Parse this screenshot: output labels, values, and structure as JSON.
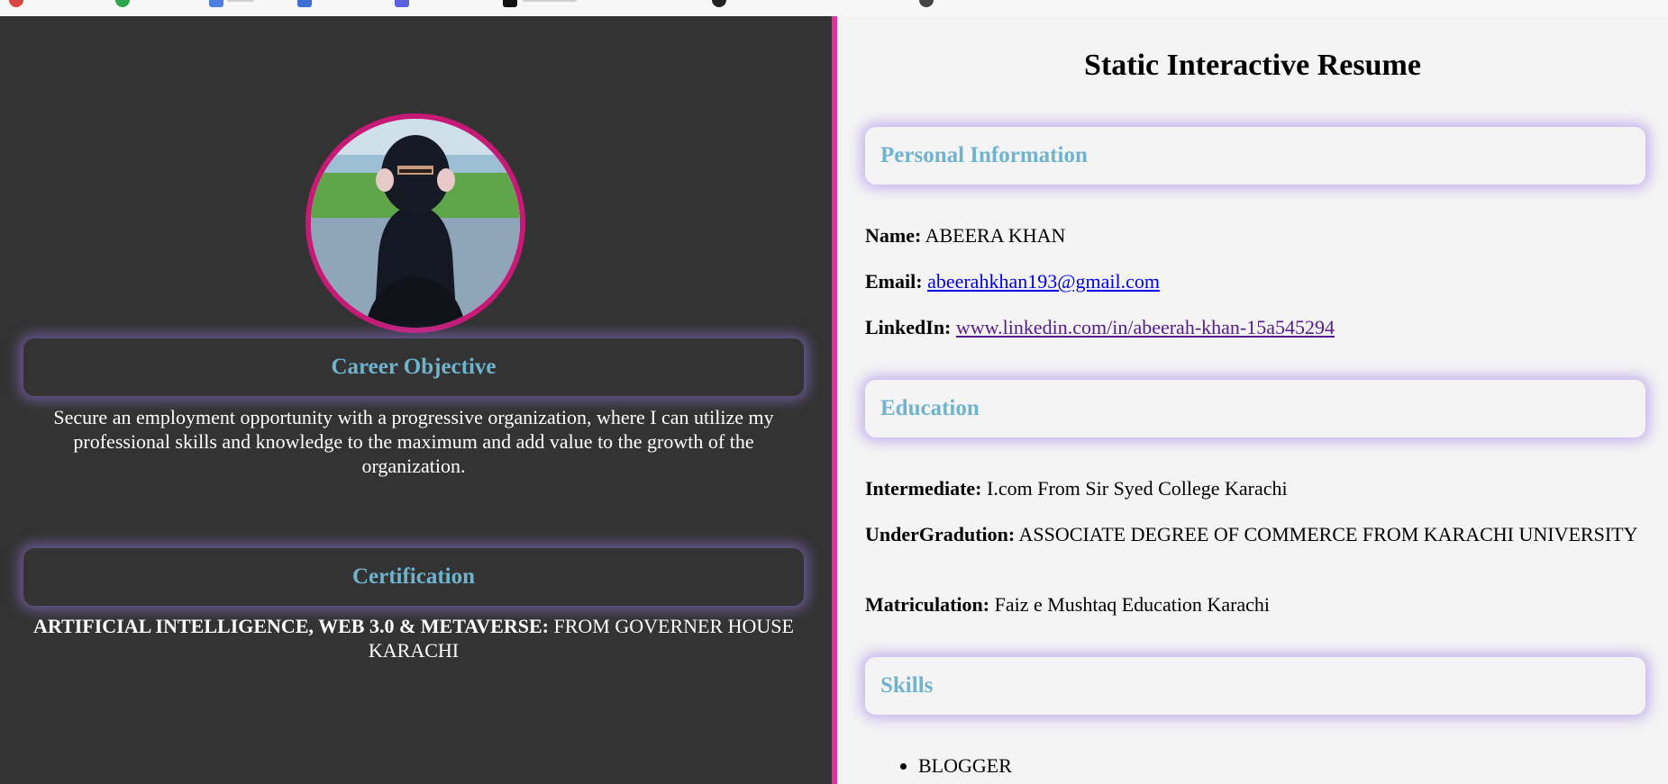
{
  "right": {
    "page_title": "Static Interactive Resume",
    "personal": {
      "heading": "Personal Information",
      "name_label": "Name:",
      "name_value": "ABEERA KHAN",
      "email_label": "Email:",
      "email_value": "abeerahkhan193@gmail.com",
      "linkedin_label": "LinkedIn:",
      "linkedin_value": "www.linkedin.com/in/abeerah-khan-15a545294"
    },
    "education": {
      "heading": "Education",
      "intermediate_label": "Intermediate:",
      "intermediate_value": "I.com From Sir Syed College Karachi",
      "undergrad_label": "UnderGradution:",
      "undergrad_value": "ASSOCIATE DEGREE OF COMMERCE FROM KARACHI UNIVERSITY",
      "matric_label": "Matriculation:",
      "matric_value": "Faiz e Mushtaq Education Karachi"
    },
    "skills": {
      "heading": "Skills",
      "items": [
        "BLOGGER"
      ]
    }
  },
  "left": {
    "career": {
      "heading": "Career Objective",
      "text": "Secure an employment opportunity with a progressive organization, where I can utilize my professional skills and knowledge to the maximum and add value to the growth of the organization."
    },
    "certification": {
      "heading": "Certification",
      "label": "ARTIFICIAL INTELLIGENCE, WEB 3.0 & METAVERSE:",
      "value": "FROM GOVERNER HOUSE KARACHI"
    }
  },
  "colors": {
    "left_bg": "#333333",
    "divider": "#e0309a",
    "heading_accent": "#6fb3cf",
    "avatar_border": "#c71a76",
    "glow": "#a082eb"
  }
}
